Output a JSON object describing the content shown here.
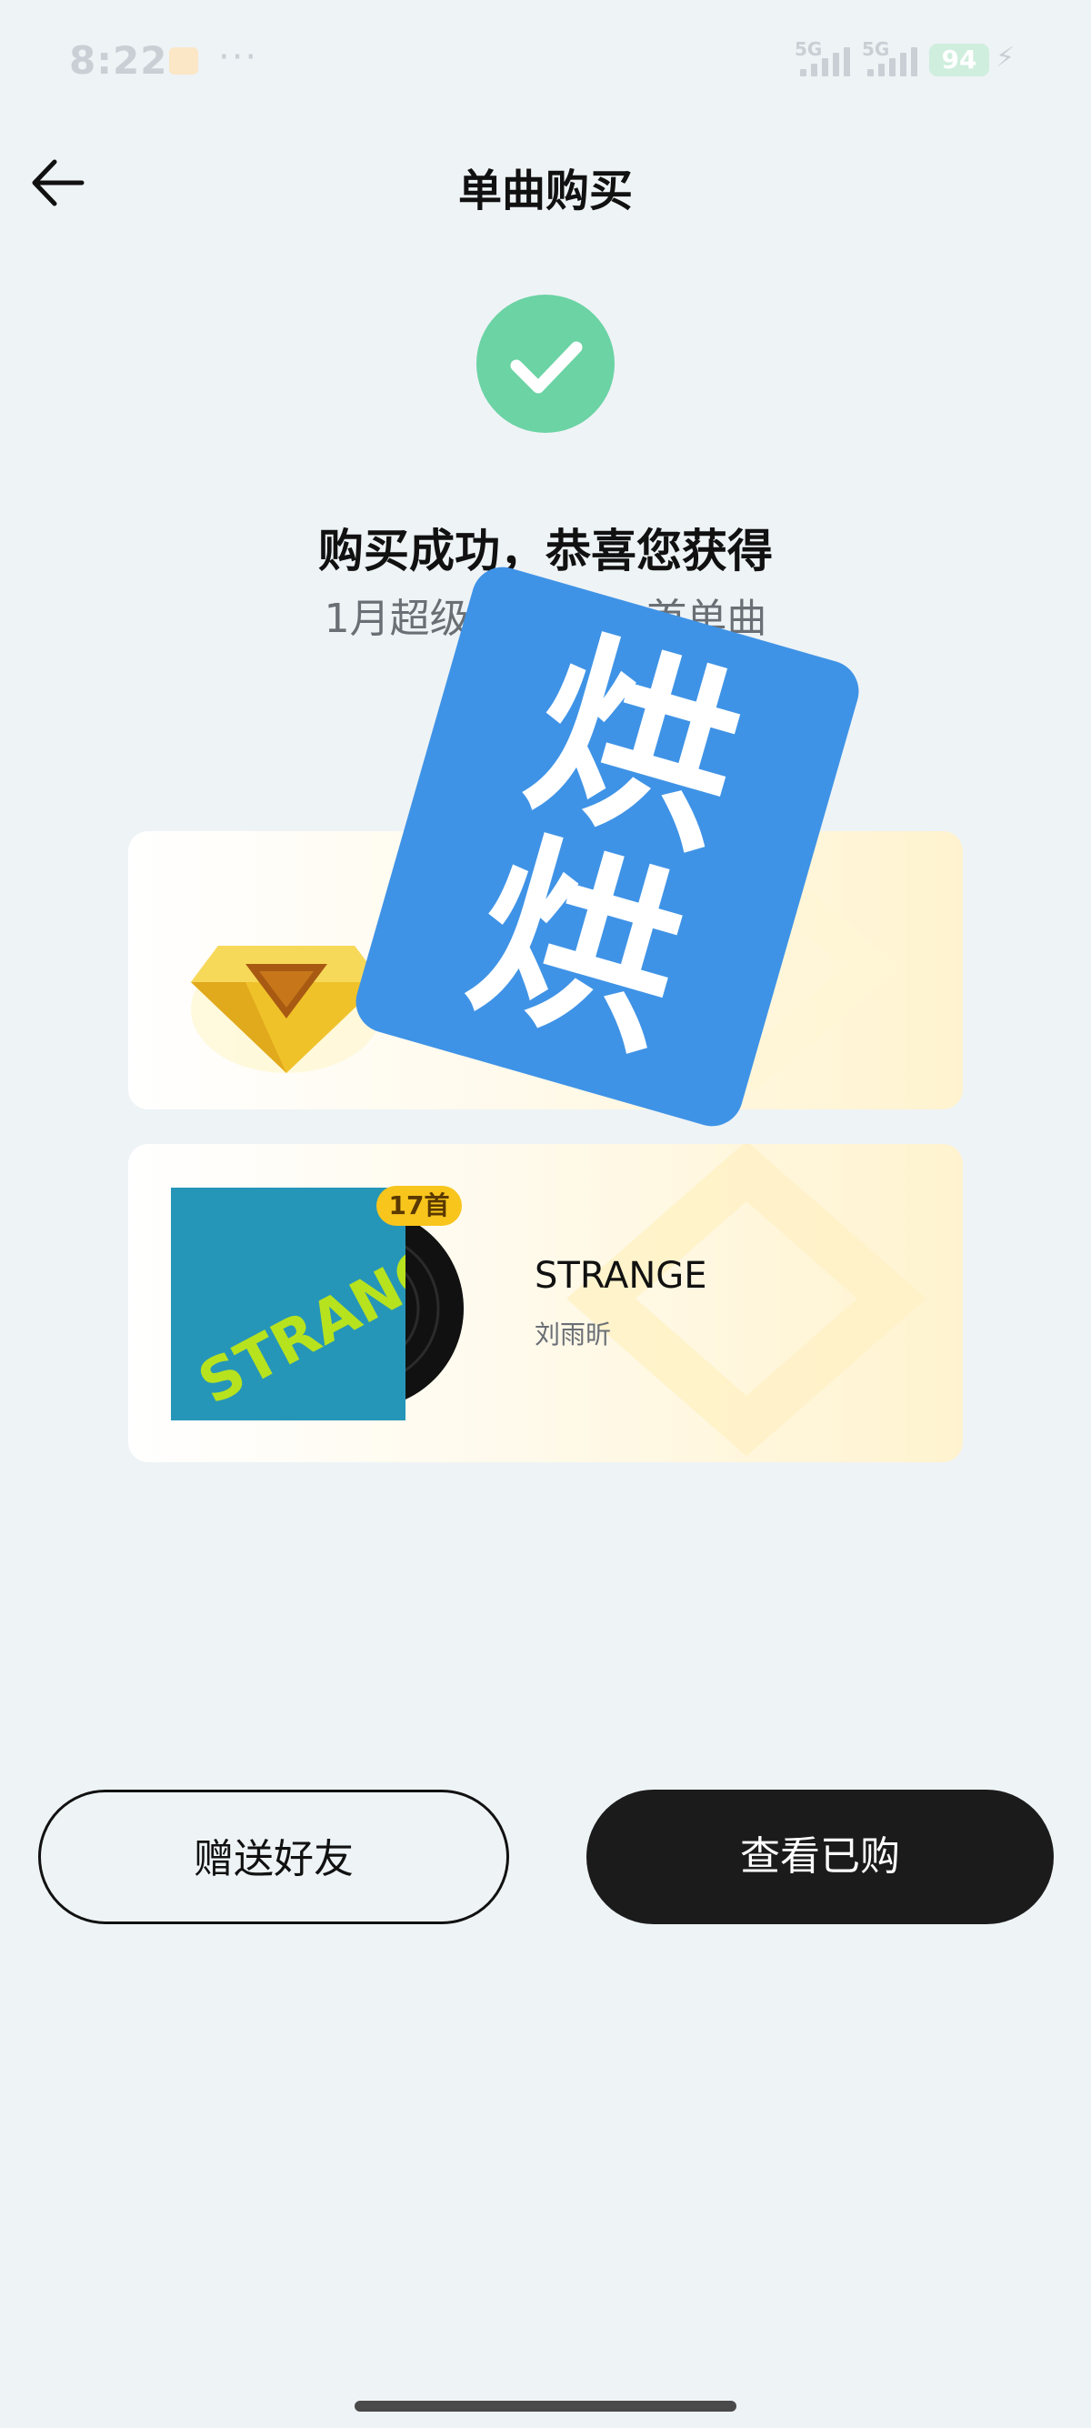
{
  "status_bar": {
    "time": "8:22",
    "more": "···",
    "signal1_label": "5G",
    "signal2_label": "5G",
    "battery": "94",
    "message_icon": "message-icon",
    "charging_icon": "bolt-icon"
  },
  "header": {
    "title": "单曲购买",
    "back_icon": "arrow-left-icon"
  },
  "result": {
    "icon": "check-circle-icon",
    "headline": "购买成功，恭喜您获得",
    "subline": "1月超级会员+17 首单曲"
  },
  "vip_card": {
    "icon": "diamond-icon"
  },
  "album_card": {
    "title": "STRANGE",
    "artist": "刘雨昕",
    "track_count_badge": "17首",
    "cover_art_text": "STRANGE"
  },
  "sticker": {
    "line1": "烘",
    "line2": "烘"
  },
  "actions": {
    "gift_label": "赠送好友",
    "view_label": "查看已购"
  },
  "colors": {
    "background": "#eef3f6",
    "success_green": "#6bd3a4",
    "badge_yellow": "#f8c51d",
    "primary_button": "#1b1b1b",
    "sticker_blue": "#3f93e6"
  }
}
